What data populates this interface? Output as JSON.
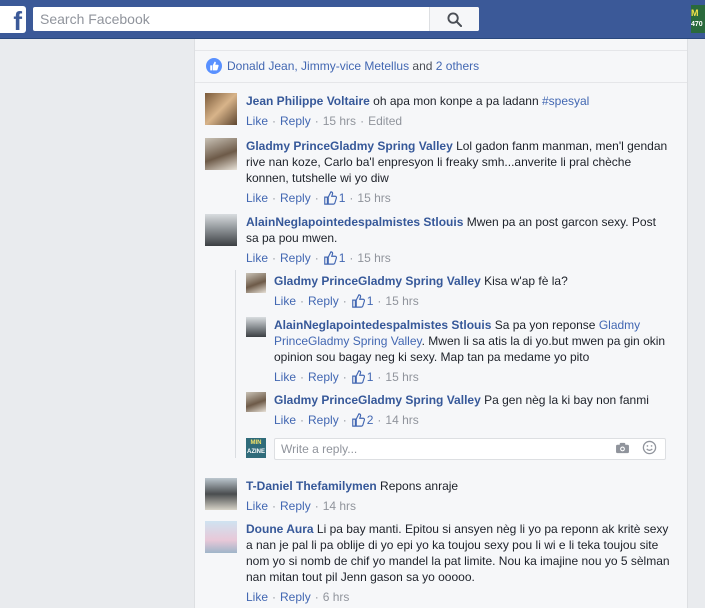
{
  "header": {
    "logo": "f",
    "search_placeholder": "Search Facebook",
    "corner_badge_top": "M",
    "corner_badge_bottom": "470"
  },
  "likes": {
    "names": "Donald Jean, Jimmy-vice Metellus",
    "and_text": " and ",
    "others": "2 others"
  },
  "actions": {
    "like": "Like",
    "reply": "Reply",
    "dot": "·"
  },
  "comments": [
    {
      "author": "Jean Philippe Voltaire",
      "text": " oh apa mon konpe a pa ladann ",
      "tag": "#spesyal",
      "time": "15 hrs",
      "edited": "Edited"
    },
    {
      "author": "Gladmy PrinceGladmy Spring Valley",
      "text": " Lol gadon fanm manman, men'l gendan rive nan koze, Carlo ba'l enpresyon li freaky smh...anverite li pral chèche konnen, tutshelle wi yo diw",
      "likes": "1",
      "time": "15 hrs"
    },
    {
      "author": "AlainNeglapointedespalmistes Stlouis",
      "text": " Mwen pa an post garcon sexy. Post sa pa pou mwen.",
      "likes": "1",
      "time": "15 hrs"
    },
    {
      "author": "T-Daniel Thefamilymen",
      "text": " Repons anraje",
      "time": "14 hrs"
    },
    {
      "author": "Doune Aura",
      "text": " Li pa bay manti. Epitou si ansyen nèg li yo pa reponn ak kritè sexy a nan je pal li pa oblije di yo epi yo ka toujou sexy pou li wi e li teka toujou site nom yo si nomb de chif yo mandel la pat limite. Nou ka imajine nou yo 5 sèlman nan mitan tout pil Jenn gason sa yo ooooo.",
      "time": "6 hrs"
    }
  ],
  "replies": [
    {
      "author": "Gladmy PrinceGladmy Spring Valley",
      "text": " Kisa w'ap fè la?",
      "likes": "1",
      "time": "15 hrs"
    },
    {
      "author": "AlainNeglapointedespalmistes Stlouis",
      "text": " Sa pa yon reponse ",
      "mention": "Gladmy PrinceGladmy Spring Valley",
      "text2": ". Mwen li sa atis la di yo.but mwen pa gin okin opinion sou bagay neg ki sexy. Map tan pa medame yo pito",
      "likes": "1",
      "time": "15 hrs"
    },
    {
      "author": "Gladmy PrinceGladmy Spring Valley",
      "text": " Pa gen nèg la ki bay non fanmi",
      "likes": "2",
      "time": "14 hrs"
    }
  ],
  "reply_box": {
    "placeholder": "Write a reply...",
    "avatar_text_top": "MIN",
    "avatar_text_bottom": "AZINE"
  },
  "colors": {
    "topbar": "#3b5998",
    "link": "#4267b2",
    "author": "#365899",
    "like_blue": "#5890ff",
    "panel": "#f6f7f9",
    "page": "#e9ebee"
  }
}
